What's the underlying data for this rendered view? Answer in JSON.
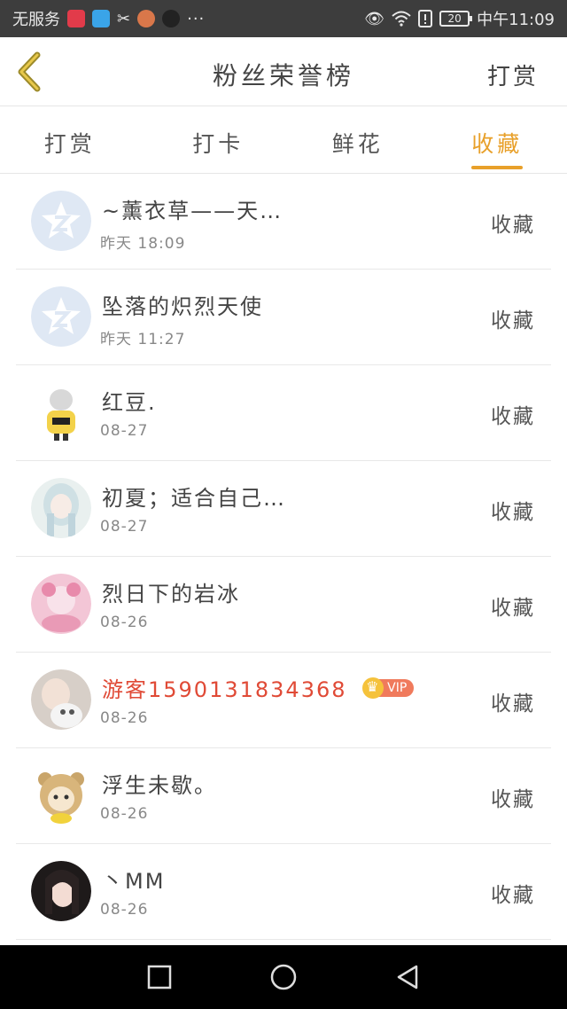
{
  "status_bar": {
    "carrier": "无服务",
    "battery": "20",
    "time": "中午11:09",
    "more": "···"
  },
  "header": {
    "title": "粉丝荣誉榜",
    "action": "打赏"
  },
  "tabs": [
    {
      "label": "打赏",
      "active": false
    },
    {
      "label": "打卡",
      "active": false
    },
    {
      "label": "鲜花",
      "active": false
    },
    {
      "label": "收藏",
      "active": true
    }
  ],
  "accent_color": "#e8a02a",
  "list": [
    {
      "name": "~薰衣草——天…",
      "time": "昨天 18:09",
      "action": "收藏",
      "avatar": "default-avatar"
    },
    {
      "name": "坠落的炽烈天使",
      "time": "昨天 11:27",
      "action": "收藏",
      "avatar": "default-avatar"
    },
    {
      "name": "红豆.",
      "time": "08-27",
      "action": "收藏",
      "avatar": "cartoon-boy-avatar"
    },
    {
      "name": "初夏；适合自己…",
      "time": "08-27",
      "action": "收藏",
      "avatar": "anime-girl-avatar"
    },
    {
      "name": "烈日下的岩冰",
      "time": "08-26",
      "action": "收藏",
      "avatar": "pink-anime-avatar"
    },
    {
      "name": "游客15901318343​68",
      "time": "08-26",
      "action": "收藏",
      "avatar": "photo-avatar",
      "vip": "VIP"
    },
    {
      "name": "浮生未歇。",
      "time": "08-26",
      "action": "收藏",
      "avatar": "cartoon-bear-avatar"
    },
    {
      "name": "丶MM",
      "time": "08-26",
      "action": "收藏",
      "avatar": "girl-photo-avatar"
    }
  ]
}
